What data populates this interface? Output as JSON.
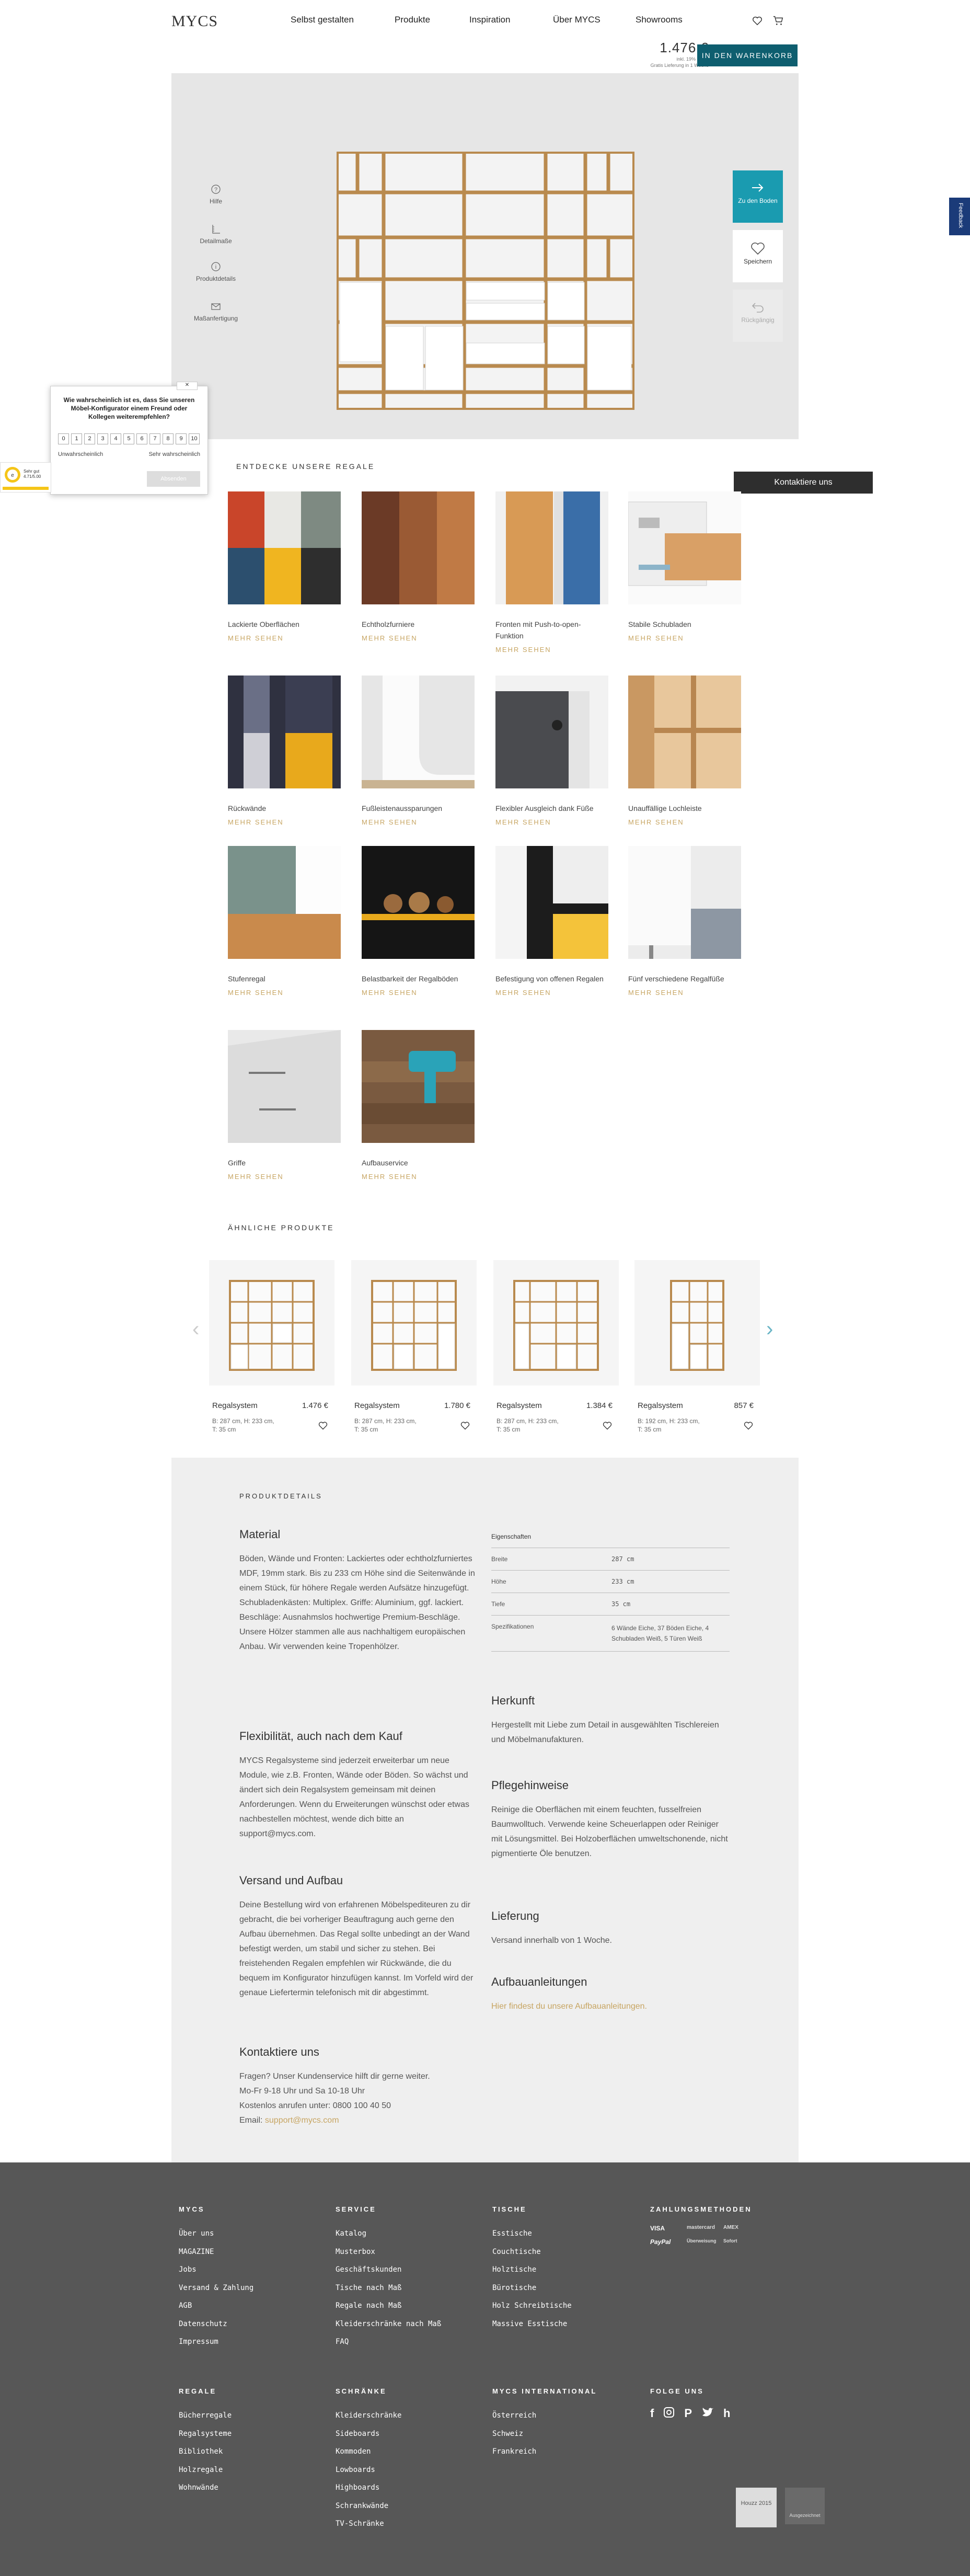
{
  "header": {
    "logo": "MYCS",
    "nav": [
      "Selbst gestalten",
      "Produkte",
      "Inspiration",
      "Über MYCS",
      "Showrooms"
    ],
    "price": "1.476 €",
    "price_note_1": "inkl. 19% MwSt",
    "price_note_2": "Gratis Lieferung in 1 Woche",
    "cart_button": "IN DEN WARENKORB"
  },
  "configurator": {
    "tools": [
      "Hilfe",
      "Detailmaße",
      "Produktdetails",
      "Maßanfertigung"
    ],
    "side_buttons": [
      "Zu den Boden",
      "Speichern",
      "Rückgängig"
    ],
    "feedback_tab": "Feedback"
  },
  "survey": {
    "question": "Wie wahrscheinlich ist es, dass Sie unseren Möbel-Konfigurator einem Freund oder Kollegen weiterempfehlen?",
    "scale": [
      "0",
      "1",
      "2",
      "3",
      "4",
      "5",
      "6",
      "7",
      "8",
      "9",
      "10"
    ],
    "low_label": "Unwahrscheinlich",
    "high_label": "Sehr wahrscheinlich",
    "send": "Absenden",
    "close": "✕",
    "trusted_text": "Sehr gut 4.71/5.00"
  },
  "features": {
    "title": "ENTDECKE UNSERE REGALE",
    "contact_button": "Kontaktiere uns",
    "link_label": "MEHR SEHEN",
    "items": [
      {
        "title": "Lackierte Oberflächen"
      },
      {
        "title": "Echtholzfurniere"
      },
      {
        "title": "Fronten mit Push-to-open-Funktion"
      },
      {
        "title": "Stabile Schubladen"
      },
      {
        "title": "Rückwände"
      },
      {
        "title": "Fußleistenaussparungen"
      },
      {
        "title": "Flexibler Ausgleich dank Füße"
      },
      {
        "title": "Unauffällige Lochleiste"
      },
      {
        "title": "Stufenregal"
      },
      {
        "title": "Belastbarkeit der Regalböden"
      },
      {
        "title": "Befestigung von offenen Regalen"
      },
      {
        "title": "Fünf verschiedene Regalfüße"
      },
      {
        "title": "Griffe"
      },
      {
        "title": "Aufbauservice"
      }
    ]
  },
  "similar": {
    "title": "ÄHNLICHE PRODUKTE",
    "products": [
      {
        "name": "Regalsystem",
        "price": "1.476 €",
        "dims": "B: 287 cm, H: 233 cm, T: 35 cm"
      },
      {
        "name": "Regalsystem",
        "price": "1.780 €",
        "dims": "B: 287 cm, H: 233 cm, T: 35 cm"
      },
      {
        "name": "Regalsystem",
        "price": "1.384 €",
        "dims": "B: 287 cm, H: 233 cm, T: 35 cm"
      },
      {
        "name": "Regalsystem",
        "price": "857 €",
        "dims": "B: 192 cm, H: 233 cm, T: 35 cm"
      }
    ]
  },
  "details": {
    "title": "PRODUKTDETAILS",
    "material_h": "Material",
    "material_p": "Böden, Wände und Fronten: Lackiertes oder echtholzfurniertes MDF, 19mm stark. Bis zu 233 cm Höhe sind die Seitenwände in einem Stück, für höhere Regale werden Aufsätze hinzugefügt. Schubladenkästen: Multiplex. Griffe: Aluminium, ggf. lackiert. Beschläge: Ausnahmslos hochwertige Premium-Beschläge. Unsere Hölzer stammen alle aus nachhaltigem europäischen Anbau. Wir verwenden keine Tropenhölzer.",
    "flex_h": "Flexibilität, auch nach dem Kauf",
    "flex_p": "MYCS Regalsysteme sind jederzeit erweiterbar um neue Module, wie z.B. Fronten, Wände oder Böden. So wächst und ändert sich dein Regalsystem gemeinsam mit deinen Anforderungen. Wenn du Erweiterungen wünschst oder etwas nachbestellen möchtest, wende dich bitte an support@mycs.com.",
    "ship_h": "Versand und Aufbau",
    "ship_p": "Deine Bestellung wird von erfahrenen Möbelspediteuren zu dir gebracht, die bei vorheriger Beauftragung auch gerne den Aufbau übernehmen. Das Regal sollte unbedingt an der Wand befestigt werden, um stabil und sicher zu stehen. Bei freistehenden Regalen empfehlen wir Rückwände, die du bequem im Konfigurator hinzufügen kannst. Im Vorfeld wird der genaue Liefertermin telefonisch mit dir abgestimmt.",
    "contact_h": "Kontaktiere uns",
    "contact_l1": "Fragen? Unser Kundenservice hilft dir gerne weiter.",
    "contact_l2": "Mo-Fr 9-18 Uhr und Sa 10-18 Uhr",
    "contact_l3": "Kostenlos anrufen unter: 0800 100 40 50",
    "contact_l4_label": "Email: ",
    "contact_l4_link": "support@mycs.com",
    "props_h": "Eigenschaften",
    "props": [
      {
        "k": "Breite",
        "v": "287 cm"
      },
      {
        "k": "Höhe",
        "v": "233 cm"
      },
      {
        "k": "Tiefe",
        "v": "35 cm"
      },
      {
        "k": "Spezifikationen",
        "v": "6 Wände Eiche, 37 Böden Eiche, 4 Schubladen Weiß, 5 Türen Weiß"
      }
    ],
    "origin_h": "Herkunft",
    "origin_p": "Hergestellt mit Liebe zum Detail in ausgewählten Tischlereien und Möbelmanufakturen.",
    "care_h": "Pflegehinweise",
    "care_p": "Reinige die Oberflächen mit einem feuchten, fusselfreien Baumwolltuch. Verwende keine Scheuerlappen oder Reiniger mit Lösungsmittel. Bei Holzoberflächen umweltschonende, nicht pigmentierte Öle benutzen.",
    "delivery_h": "Lieferung",
    "delivery_p": "Versand innerhalb von 1 Woche.",
    "assembly_h": "Aufbauanleitungen",
    "assembly_link": "Hier findest du unsere Aufbauanleitungen."
  },
  "footer": {
    "cols": [
      {
        "title": "MYCS",
        "links": [
          "Über uns",
          "MAGAZINE",
          "Jobs",
          "Versand & Zahlung",
          "AGB",
          "Datenschutz",
          "Impressum"
        ]
      },
      {
        "title": "SERVICE",
        "links": [
          "Katalog",
          "Musterbox",
          "Geschäftskunden",
          "Tische nach Maß",
          "Regale nach Maß",
          "Kleiderschränke nach Maß",
          "FAQ"
        ]
      },
      {
        "title": "TISCHE",
        "links": [
          "Esstische",
          "Couchtische",
          "Holztische",
          "Bürotische",
          "Holz Schreibtische",
          "Massive Esstische"
        ]
      },
      {
        "title": "REGALE",
        "links": [
          "Bücherregale",
          "Regalsysteme",
          "Bibliothek",
          "Holzregale",
          "Wohnwände"
        ]
      },
      {
        "title": "SCHRÄNKE",
        "links": [
          "Kleiderschränke",
          "Sideboards",
          "Kommoden",
          "Lowboards",
          "Highboards",
          "Schrankwände",
          "TV-Schränke"
        ]
      },
      {
        "title": "MYCS INTERNATIONAL",
        "links": [
          "Österreich",
          "Schweiz",
          "Frankreich"
        ]
      }
    ],
    "payment_h": "ZAHLUNGSMETHODEN",
    "payments": [
      "VISA",
      "mastercard",
      "AMEX",
      "PayPal",
      "Überweisung",
      "Sofort"
    ],
    "social_h": "FOLGE UNS",
    "social": [
      "facebook-icon",
      "instagram-icon",
      "pinterest-icon",
      "twitter-icon",
      "houzz-icon"
    ],
    "badge_1": "Houzz 2015",
    "badge_2": "Ausgezeichnet"
  }
}
